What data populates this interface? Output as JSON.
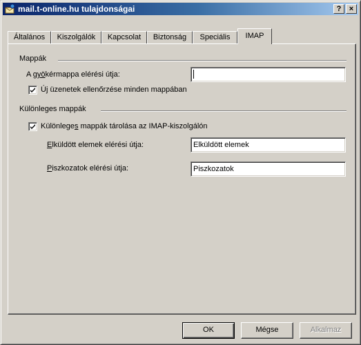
{
  "window": {
    "title": "mail.t-online.hu tulajdonságai",
    "help_button": "?",
    "close_button": "×"
  },
  "tabs": [
    {
      "label": "Általános",
      "active": false
    },
    {
      "label": "Kiszolgálók",
      "active": false
    },
    {
      "label": "Kapcsolat",
      "active": false
    },
    {
      "label": "Biztonság",
      "active": false
    },
    {
      "label": "Speciális",
      "active": false
    },
    {
      "label": "IMAP",
      "active": true
    }
  ],
  "folders_group": {
    "title": "Mappák",
    "root_path_label_pre": "A ",
    "root_path_label_accel": "gyö",
    "root_path_label_post": "kérmappa elérési útja:",
    "root_path_value": "",
    "check_all_folders_label": "Új üzenetek ellenőrzése minden mappában",
    "check_all_folders_checked": true
  },
  "special_group": {
    "title": "Különleges mappák",
    "store_on_server_label_pre": "Különlege",
    "store_on_server_label_accel": "s",
    "store_on_server_label_post": " mappák tárolása az IMAP-kiszolgálón",
    "store_on_server_checked": true,
    "sent_label_accel": "E",
    "sent_label_post": "lküldött elemek elérési útja:",
    "sent_value": "Elküldött elemek",
    "drafts_label_accel": "P",
    "drafts_label_post": "iszkozatok elérési útja:",
    "drafts_value": "Piszkozatok"
  },
  "buttons": {
    "ok": "OK",
    "cancel": "Mégse",
    "apply": "Alkalmaz"
  }
}
